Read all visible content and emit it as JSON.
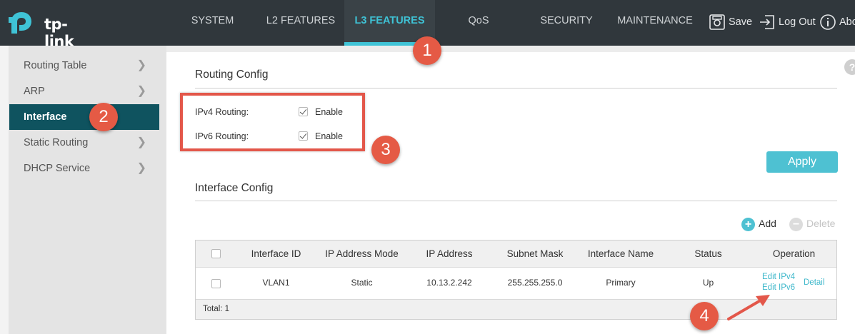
{
  "brand": {
    "name": "tp-link"
  },
  "nav": {
    "items": [
      {
        "label": "SYSTEM"
      },
      {
        "label": "L2 FEATURES"
      },
      {
        "label": "L3 FEATURES"
      },
      {
        "label": "QoS"
      },
      {
        "label": "SECURITY"
      },
      {
        "label": "MAINTENANCE"
      }
    ],
    "active": "L3 FEATURES"
  },
  "toolbar": {
    "save_label": "Save",
    "logout_label": "Log Out",
    "about_label": "About"
  },
  "sidebar": {
    "items": [
      {
        "label": "Routing Table"
      },
      {
        "label": "ARP"
      },
      {
        "label": "Interface"
      },
      {
        "label": "Static Routing"
      },
      {
        "label": "DHCP Service"
      }
    ],
    "active": "Interface"
  },
  "routing_config": {
    "title": "Routing Config",
    "ipv4_label": "IPv4 Routing:",
    "ipv6_label": "IPv6 Routing:",
    "enable_label": "Enable",
    "ipv4_enabled": true,
    "ipv6_enabled": true,
    "apply_label": "Apply"
  },
  "interface_config": {
    "title": "Interface Config",
    "add_label": "Add",
    "delete_label": "Delete",
    "columns": [
      "Interface ID",
      "IP Address Mode",
      "IP Address",
      "Subnet Mask",
      "Interface Name",
      "Status",
      "Operation"
    ],
    "rows": [
      {
        "interface_id": "VLAN1",
        "ip_mode": "Static",
        "ip_address": "10.13.2.242",
        "subnet_mask": "255.255.255.0",
        "interface_name": "Primary",
        "status": "Up",
        "edit_ipv4": "Edit IPv4",
        "edit_ipv6": "Edit IPv6",
        "detail": "Detail"
      }
    ],
    "total": "Total: 1"
  },
  "annotations": [
    "1",
    "2",
    "3",
    "4"
  ],
  "colors": {
    "accent": "#3fc3d6",
    "topbar": "#30373c",
    "sidebar_active": "#0f535f",
    "highlight": "#e3574a",
    "badge": "#e55a45"
  }
}
